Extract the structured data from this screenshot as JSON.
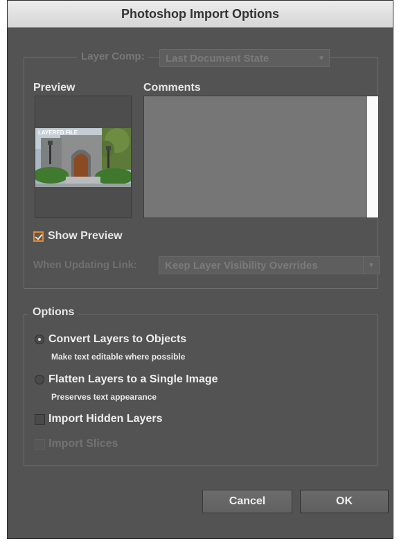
{
  "window": {
    "title": "Photoshop Import Options"
  },
  "layer_comp": {
    "label": "Layer Comp:",
    "value": "Last Document State"
  },
  "preview": {
    "label": "Preview",
    "thumbnail_text": "LAYERED FILE"
  },
  "comments": {
    "label": "Comments"
  },
  "show_preview": {
    "label": "Show Preview",
    "checked": true
  },
  "update_link": {
    "label": "When Updating Link:",
    "value": "Keep Layer Visibility Overrides"
  },
  "options": {
    "legend": "Options",
    "convert": {
      "label": "Convert Layers to Objects",
      "sub": "Make text editable where possible",
      "selected": true
    },
    "flatten": {
      "label": "Flatten Layers to a Single Image",
      "sub": "Preserves text appearance",
      "selected": false
    },
    "import_hidden": {
      "label": "Import Hidden Layers",
      "checked": false
    },
    "import_slices": {
      "label": "Import Slices",
      "checked": false,
      "disabled": true
    }
  },
  "buttons": {
    "cancel": "Cancel",
    "ok": "OK"
  },
  "colors": {
    "dialog_bg": "#535353",
    "accent": "#e08a2b"
  }
}
